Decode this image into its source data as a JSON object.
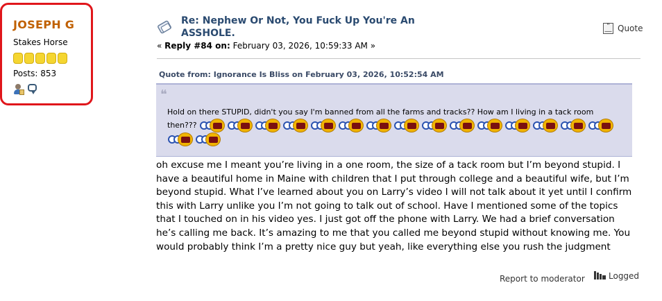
{
  "poster": {
    "name": "JOSEPH G",
    "title": "Stakes Horse",
    "stars": 5,
    "posts_label": "Posts: 853",
    "icons": [
      "profile-icon",
      "personal-message-icon"
    ]
  },
  "post": {
    "title": "Re: Nephew Or Not, You Fuck Up You're An ASSHOLE.",
    "meta_prefix": "« ",
    "reply_label": "Reply #84 on:",
    "date": " February 03, 2026, 10:59:33 AM »",
    "quote_button": "Quote"
  },
  "quote": {
    "header": "Quote from: Ignorance Is Bliss on February 03, 2026, 10:52:54 AM",
    "text": "Hold on there STUPID, didn't you say I'm banned from all the farms and tracks?? How am I living in a tack room then???",
    "smiley_count": 17
  },
  "body": "oh excuse me I meant you’re living in a one room, the size of a tack room but I’m beyond stupid. I have a beautiful home in Maine with children that I put through college and a beautiful wife, but I’m beyond stupid. What I’ve learned about you on Larry’s video I will not talk about it yet until I confirm this with Larry unlike you I’m not going to talk out of school. Have I mentioned some of the topics that I touched on in his video yes. I just got off the phone with Larry. We had a brief conversation he’s calling me back. It’s amazing to me that you called me beyond stupid without knowing me. You would probably think I’m a pretty nice guy but yeah, like everything else you rush the judgment",
  "footer": {
    "report": "Report to moderator",
    "logged": "Logged"
  },
  "colors": {
    "highlight_border": "#e0161b",
    "poster_name": "#c06000",
    "title": "#2a4a70",
    "quote_bg": "#dadbec"
  }
}
